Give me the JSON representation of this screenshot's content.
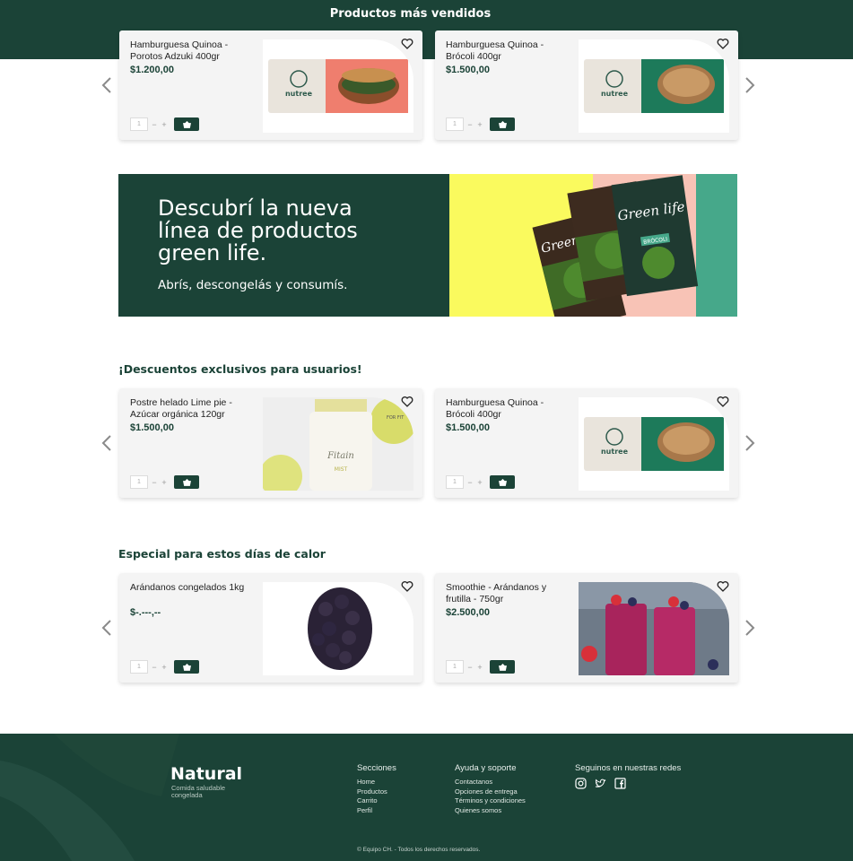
{
  "header": {
    "title": "Productos más vendidos"
  },
  "sections": [
    {
      "title": "",
      "products": [
        {
          "name": "Hamburguesa Quinoa - Porotos Adzuki 400gr",
          "price": "$1.200,00",
          "qty": "1"
        },
        {
          "name": "Hamburguesa Quinoa - Brócoli 400gr",
          "price": "$1.500,00",
          "qty": "1"
        }
      ]
    },
    {
      "title": "¡Descuentos exclusivos para usuarios!",
      "products": [
        {
          "name": "Postre helado Lime pie - Azúcar orgánica 120gr",
          "price": "$1.500,00",
          "qty": "1"
        },
        {
          "name": "Hamburguesa Quinoa - Brócoli 400gr",
          "price": "$1.500,00",
          "qty": "1"
        }
      ]
    },
    {
      "title": "Especial para estos días de calor",
      "products": [
        {
          "name": "Arándanos congelados 1kg",
          "price": "$-.---,--",
          "qty": "1"
        },
        {
          "name": "Smoothie - Arándanos y frutilla - 750gr",
          "price": "$2.500,00",
          "qty": "1"
        }
      ]
    }
  ],
  "qty_controls": {
    "minus": "−",
    "plus": "+"
  },
  "banner": {
    "headline": "Descubrí la nueva línea de productos green life.",
    "subtitle": "Abrís, descongelás y consumís.",
    "pack_brand": "nutree",
    "pack_line": "Green life",
    "pack_label": "BRÓCOLI"
  },
  "images": {
    "pack_brand": "nutree",
    "jar_text": "Fitain",
    "jar_label": "MIST",
    "jar_badge": "FOR FIT"
  },
  "footer": {
    "brand": "Natural",
    "tagline": "Comida saludable congelada",
    "columns": [
      {
        "heading": "Secciones",
        "links": [
          "Home",
          "Productos",
          "Carrito",
          "Perfil"
        ]
      },
      {
        "heading": "Ayuda y soporte",
        "links": [
          "Contactanos",
          "Opciones de entrega",
          "Términos y condiciones",
          "Quienes somos"
        ]
      },
      {
        "heading": "Seguinos en nuestras redes",
        "links": []
      }
    ],
    "social_icons": [
      "instagram-icon",
      "twitter-icon",
      "facebook-icon"
    ],
    "copyright": "© Equipo CH. - Todos los derechos reservados."
  },
  "colors": {
    "primary": "#1b4337",
    "banner_yellow": "#fafa5e",
    "banner_pink": "#f8c3b6",
    "banner_teal": "#46a88a"
  }
}
